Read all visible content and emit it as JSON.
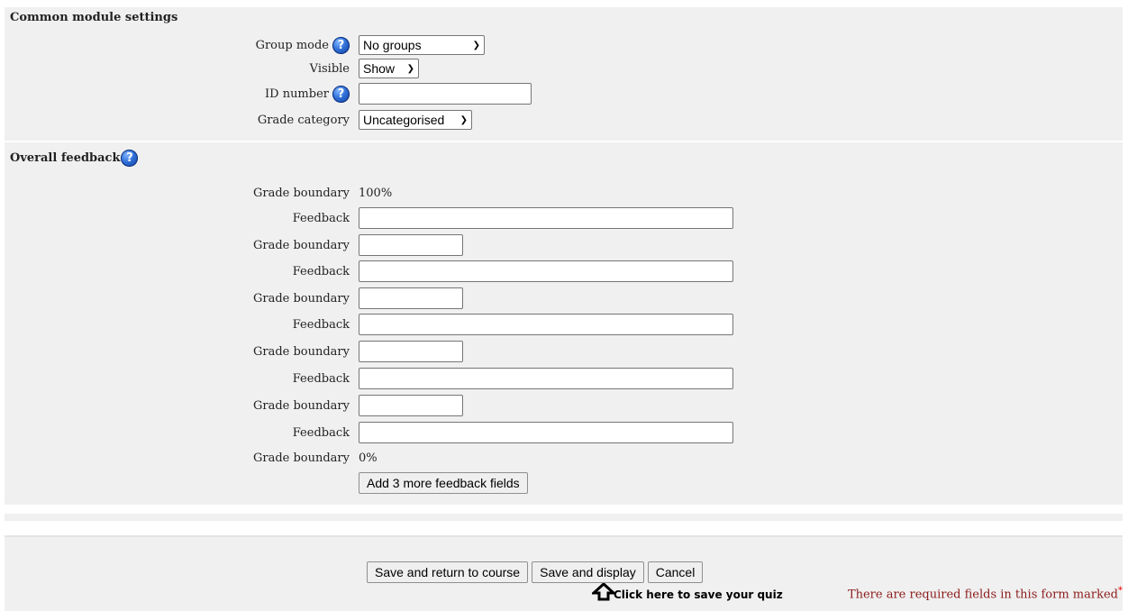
{
  "common_module": {
    "legend": "Common module settings",
    "group_mode": {
      "label": "Group mode",
      "value": "No groups"
    },
    "visible": {
      "label": "Visible",
      "value": "Show"
    },
    "id_number": {
      "label": "ID number",
      "value": ""
    },
    "grade_category": {
      "label": "Grade category",
      "value": "Uncategorised"
    }
  },
  "overall_feedback": {
    "legend": "Overall feedback",
    "grade_boundary_label": "Grade boundary",
    "feedback_label": "Feedback",
    "top_boundary": "100%",
    "bottom_boundary": "0%",
    "rows": [
      {
        "type": "boundary-static",
        "value": "100%"
      },
      {
        "type": "feedback",
        "value": ""
      },
      {
        "type": "boundary",
        "value": ""
      },
      {
        "type": "feedback",
        "value": ""
      },
      {
        "type": "boundary",
        "value": ""
      },
      {
        "type": "feedback",
        "value": ""
      },
      {
        "type": "boundary",
        "value": ""
      },
      {
        "type": "feedback",
        "value": ""
      },
      {
        "type": "boundary",
        "value": ""
      },
      {
        "type": "feedback",
        "value": ""
      },
      {
        "type": "boundary-static",
        "value": "0%"
      }
    ],
    "add_fields_button": "Add 3 more feedback fields"
  },
  "footer": {
    "save_return": "Save and return to course",
    "save_display": "Save and display",
    "cancel": "Cancel",
    "hint": "Click here to save your quiz",
    "required_note": "There are required fields in this form marked",
    "required_marker": "*"
  },
  "icons": {
    "help": "help-icon",
    "arrow": "arrow-up-icon",
    "dropdown": "chevron-down-icon"
  },
  "colors": {
    "panel_bg": "#f0f0f0",
    "required_text": "#8b1a1a",
    "help_icon": "#2f6fd6"
  }
}
